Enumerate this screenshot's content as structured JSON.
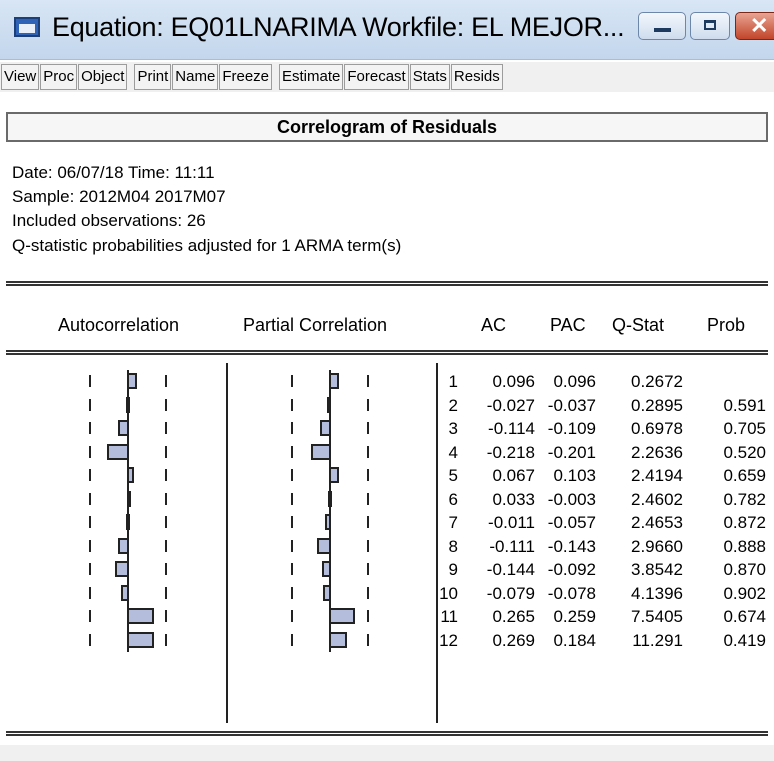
{
  "window": {
    "title": "Equation: EQ01LNARIMA   Workfile: EL MEJOR...",
    "controls": {
      "minimize_icon": "minimize-icon",
      "maximize_icon": "maximize-icon",
      "close_icon": "close-icon",
      "close_glyph": "✕"
    }
  },
  "toolbar": {
    "buttons": [
      "View",
      "Proc",
      "Object",
      "Print",
      "Name",
      "Freeze",
      "Estimate",
      "Forecast",
      "Stats",
      "Resids"
    ]
  },
  "view": {
    "header": "Correlogram of Residuals",
    "info": [
      "Date: 06/07/18   Time: 11:11",
      "Sample: 2012M04 2017M07",
      "Included observations: 26",
      "Q-statistic probabilities adjusted for 1 ARMA term(s)"
    ]
  },
  "table": {
    "columns": [
      "Autocorrelation",
      "Partial Correlation",
      "AC",
      "PAC",
      "Q-Stat",
      "Prob"
    ],
    "rows": [
      {
        "lag": "1",
        "ac": "0.096",
        "pac": "0.096",
        "q": "0.2672",
        "prob": ""
      },
      {
        "lag": "2",
        "ac": "-0.027",
        "pac": "-0.037",
        "q": "0.2895",
        "prob": "0.591"
      },
      {
        "lag": "3",
        "ac": "-0.114",
        "pac": "-0.109",
        "q": "0.6978",
        "prob": "0.705"
      },
      {
        "lag": "4",
        "ac": "-0.218",
        "pac": "-0.201",
        "q": "2.2636",
        "prob": "0.520"
      },
      {
        "lag": "5",
        "ac": "0.067",
        "pac": "0.103",
        "q": "2.4194",
        "prob": "0.659"
      },
      {
        "lag": "6",
        "ac": "0.033",
        "pac": "-0.003",
        "q": "2.4602",
        "prob": "0.782"
      },
      {
        "lag": "7",
        "ac": "-0.011",
        "pac": "-0.057",
        "q": "2.4653",
        "prob": "0.872"
      },
      {
        "lag": "8",
        "ac": "-0.111",
        "pac": "-0.143",
        "q": "2.9660",
        "prob": "0.888"
      },
      {
        "lag": "9",
        "ac": "-0.144",
        "pac": "-0.092",
        "q": "3.8542",
        "prob": "0.870"
      },
      {
        "lag": "10",
        "ac": "-0.079",
        "pac": "-0.078",
        "q": "4.1396",
        "prob": "0.902"
      },
      {
        "lag": "11",
        "ac": "0.265",
        "pac": "0.259",
        "q": "7.5405",
        "prob": "0.674"
      },
      {
        "lag": "12",
        "ac": "0.269",
        "pac": "0.184",
        "q": "11.291",
        "prob": "0.419"
      }
    ]
  },
  "colors": {
    "bar_fill": "#b4bddb",
    "title_bar": "#c9dbef",
    "close_button": "#c8452c"
  }
}
